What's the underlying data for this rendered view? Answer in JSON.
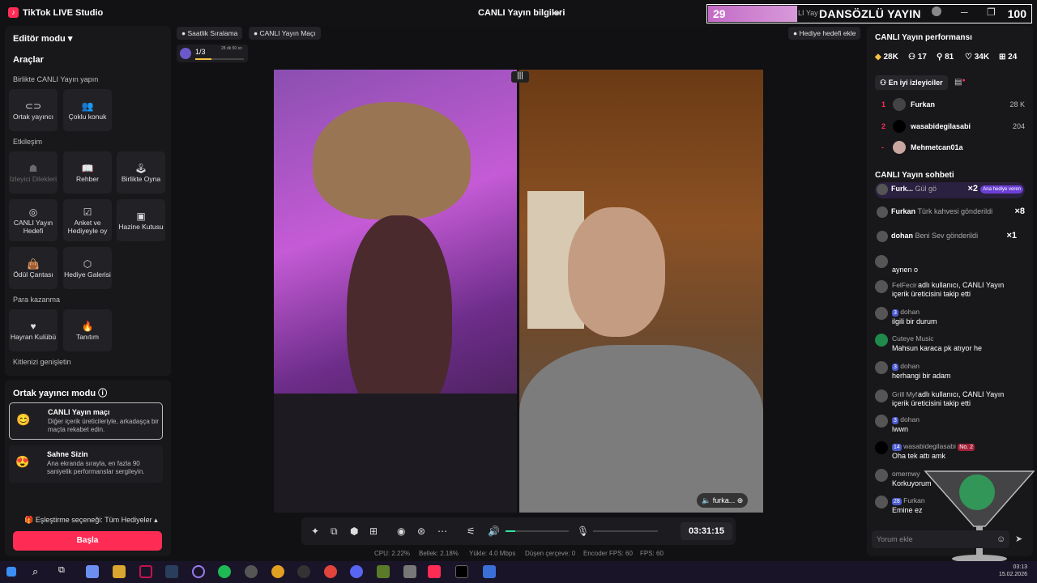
{
  "app": {
    "title": "TikTok LIVE Studio",
    "center_title": "CANLI Yayın bilgileri"
  },
  "overlay": {
    "left_number": "29",
    "title": "DANSÖZLÜ YAYIN",
    "faded": "LI Yay",
    "right_number": "100"
  },
  "left": {
    "editor_mode": "Editör modu",
    "tools_title": "Araçlar",
    "section_together": "Birlikte CANLI Yayın yapın",
    "section_engagement": "Etkileşim",
    "section_money": "Para kazanma",
    "section_audience": "Kitlenizi genişletin",
    "tools": {
      "cohost": "Ortak yayıncı",
      "multi_guest": "Çoklu konuk",
      "viewer_requests": "İzleyici Dilekleri",
      "guide": "Rehber",
      "play_together": "Birlikte Oyna",
      "live_goal": "CANLI Yayın Hedefi",
      "poll": "Anket ve Hediyeyle oy",
      "treasure": "Hazine Kutusu",
      "reward_bag": "Ödül Çantası",
      "gift_gallery": "Hediye Galerisi",
      "fan_club": "Hayran Kulübü",
      "promote": "Tanıtım"
    }
  },
  "cohost_panel": {
    "title": "Ortak yayıncı modu",
    "cards": [
      {
        "title": "CANLI Yayın maçı",
        "desc": "Diğer içerik üreticileriyle, arkadaşça bir maçta rekabet edin."
      },
      {
        "title": "Sahne Sizin",
        "desc": "Ana ekranda sırayla, en fazla 90 saniyelik performanslar sergileyin."
      }
    ],
    "match_option": "Eşleştirme seçeneği: Tüm Hediyeler",
    "start": "Başla"
  },
  "center": {
    "chip_hourly": "Saatlik Sıralama",
    "chip_match": "CANLI Yayın Maçı",
    "chip_gift_goal": "Hediye hedefi ekle",
    "progress_count": "1/3",
    "progress_time": "28 dk 50 sn",
    "progress_value": 0.33,
    "video_name": "furka...",
    "timer": "03:31:15",
    "stats": {
      "cpu": "CPU:  2.22%",
      "mem": "Bellek:  2.18%",
      "upload": "Yükle:  4.0 Mbps",
      "drop": "Düşen çerçeve:  0",
      "enc": "Encoder FPS:  60",
      "fps": "FPS:  60"
    }
  },
  "right": {
    "perf_title": "CANLI Yayın performansı",
    "metrics": [
      {
        "icon": "diamond-icon",
        "value": "28K"
      },
      {
        "icon": "people-icon",
        "value": "17"
      },
      {
        "icon": "follower-icon",
        "value": "81"
      },
      {
        "icon": "heart-icon",
        "value": "34K"
      },
      {
        "icon": "gift-icon",
        "value": "24"
      }
    ],
    "top_viewers_tab": "En iyi izleyiciler",
    "viewers": [
      {
        "rank": "1",
        "name": "Furkan",
        "score": "28 K"
      },
      {
        "rank": "2",
        "name": "wasabidegilasabi",
        "score": "204"
      },
      {
        "rank": "-",
        "name": "Mehmetcan01a",
        "score": ""
      }
    ],
    "chat_title": "CANLI Yayın sohbeti",
    "gifts": [
      {
        "name": "Furk...",
        "text": "Gül gö",
        "count": "×2",
        "tag": "Ana hediye veren"
      },
      {
        "name": "Furkan",
        "text": "Türk kahvesi gönderildi",
        "count": "×8"
      },
      {
        "name": "dohan",
        "text": "Beni Sev gönderildi",
        "count": "×1"
      }
    ],
    "chat": [
      {
        "head": "",
        "body": "aynen o"
      },
      {
        "head": "FelFecir",
        "body": "adlı kullanıcı, CANLI Yayın içerik üreticisini takip etti"
      },
      {
        "head": "dohan",
        "badge": "3",
        "body": "ilgili bir durum"
      },
      {
        "head": "Cuteye Music",
        "body": "Mahsun karaca pk atıyor he"
      },
      {
        "head": "dohan",
        "badge": "3",
        "body": "herhangi bir adam"
      },
      {
        "head": "Grill Myf",
        "body": "adlı kullanıcı, CANLI Yayın içerik üreticisini takip etti"
      },
      {
        "head": "dohan",
        "badge": "3",
        "body": "lwwn"
      },
      {
        "head": "wasabidegilasabi",
        "badge": "14",
        "extra": "No. 2",
        "body": "Oha tek attı amk"
      },
      {
        "head": "omernwy",
        "body": "Korkuyorum"
      },
      {
        "head": "Furkan",
        "badge": "28",
        "body": "Emine ez"
      }
    ],
    "comment_placeholder": "Yorum ekle"
  },
  "taskbar": {
    "time": "03:13",
    "date": "15.02.2026"
  },
  "colors": {
    "accent": "#fe2c55",
    "panel": "#18181b",
    "bg": "#111114"
  }
}
